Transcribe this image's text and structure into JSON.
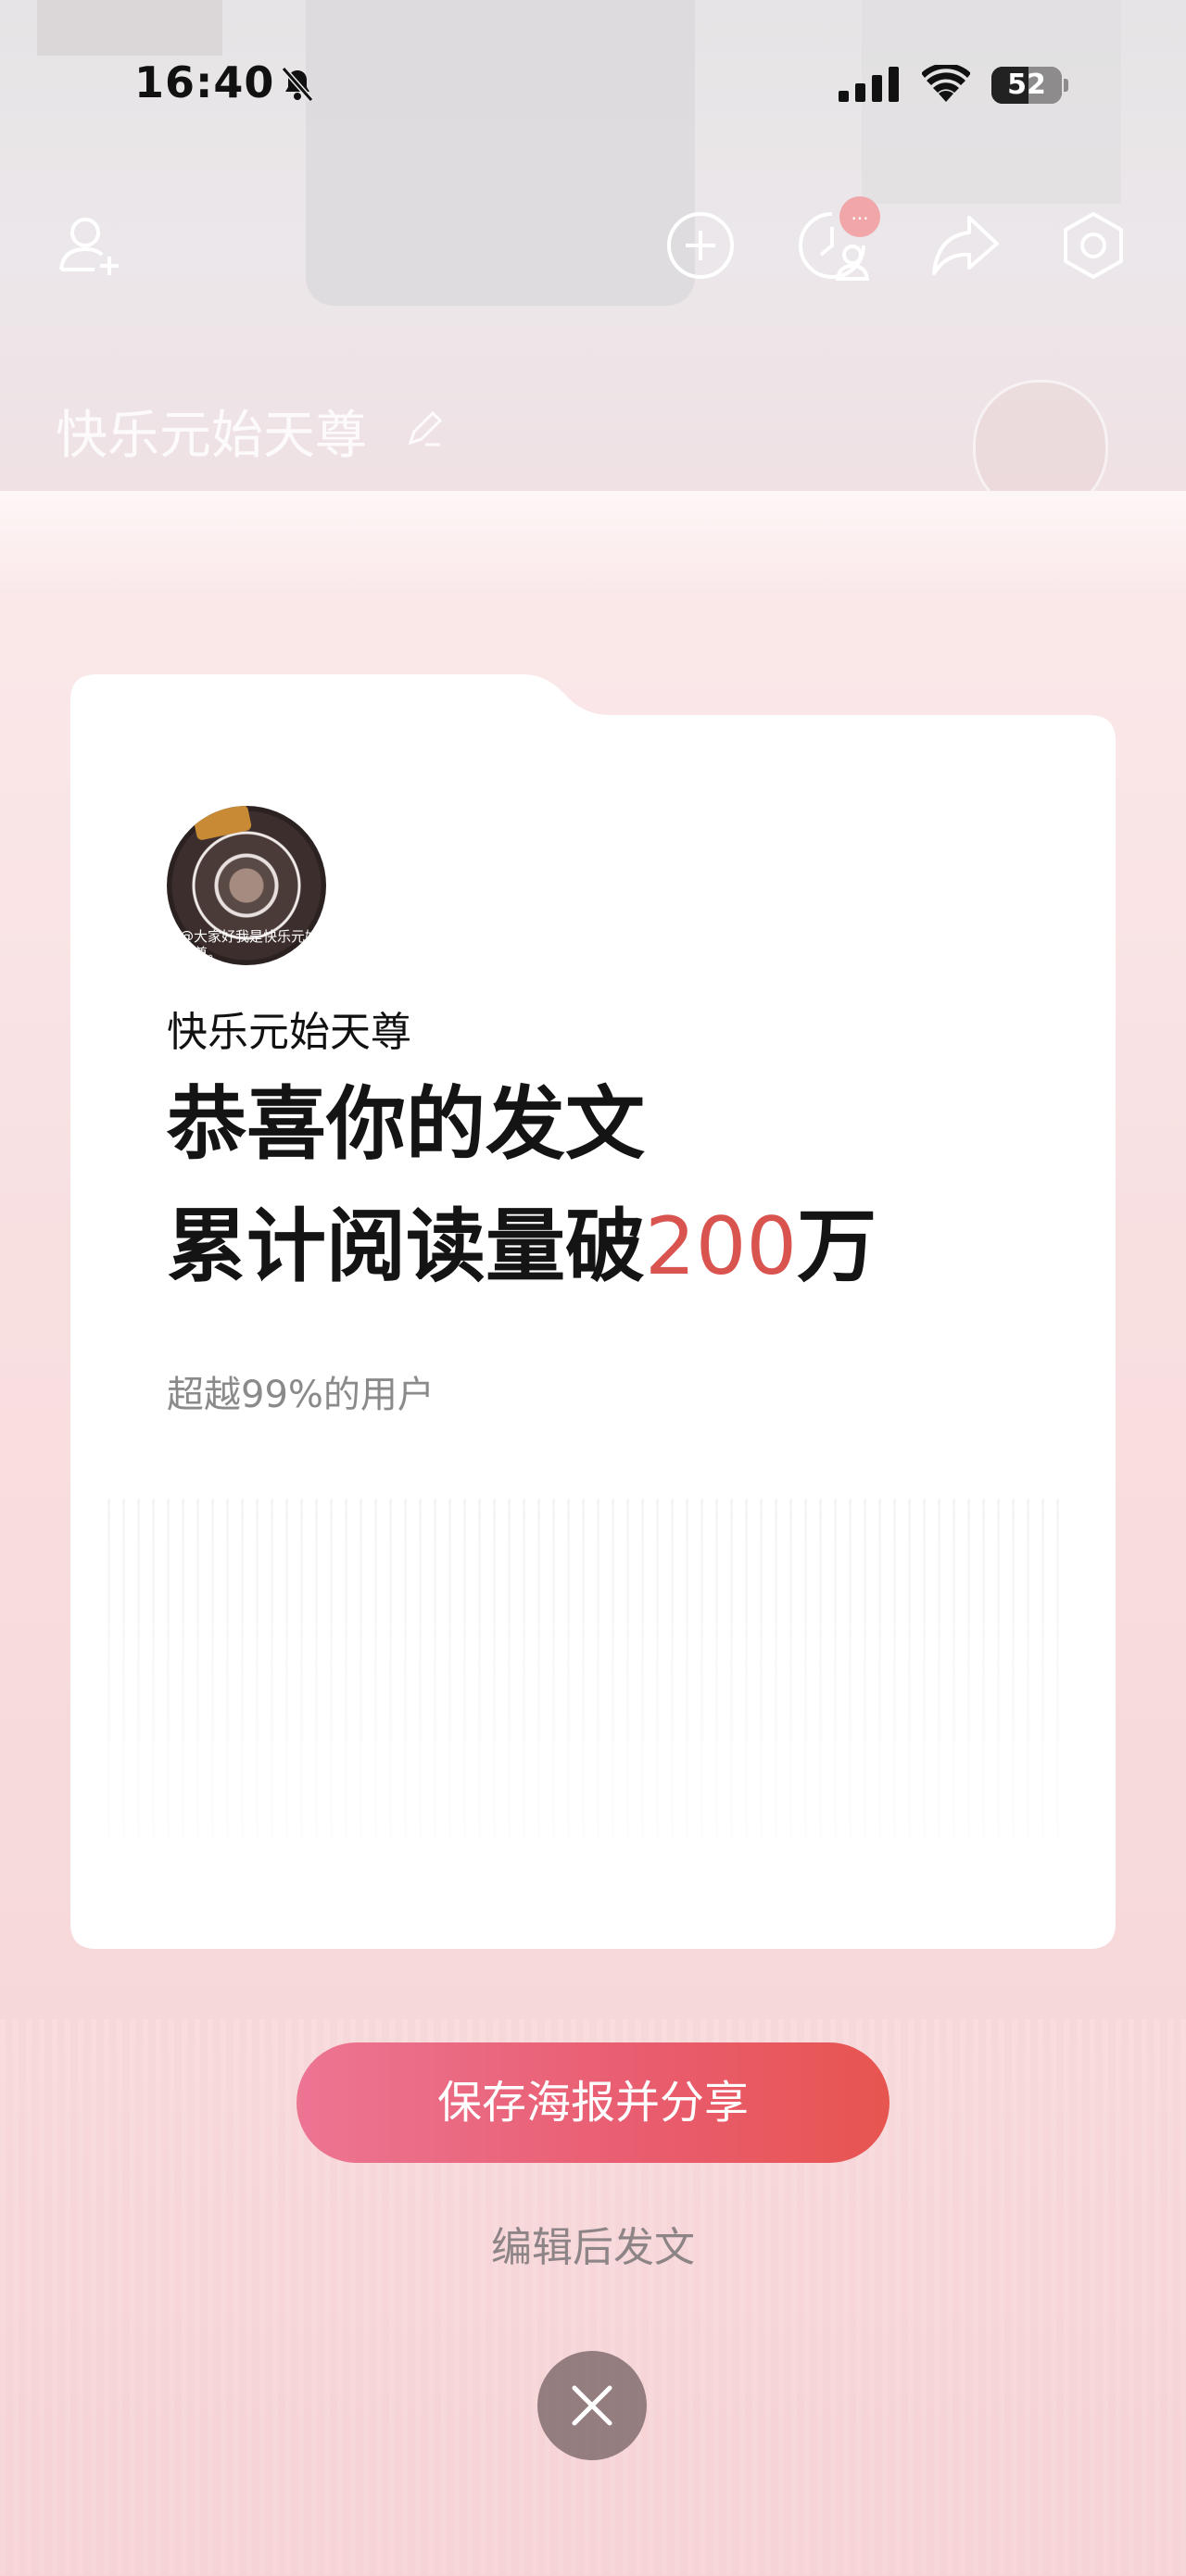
{
  "status_bar": {
    "time": "16:40",
    "battery": "52",
    "battery_percent": 52
  },
  "nav": {
    "icons": [
      "add-friend-icon",
      "add-circle-icon",
      "visitors-icon",
      "share-icon",
      "settings-icon"
    ],
    "badge_text": "..."
  },
  "profile": {
    "name": "快乐元始天尊"
  },
  "poster": {
    "username": "快乐元始天尊",
    "headline_line1": "恭喜你的发文",
    "headline_line2_prefix": "累计阅读量破",
    "headline_number": "200",
    "headline_suffix": "万",
    "subtitle": "超越99%的用户",
    "avatar_caption": "@大家好我是快乐元始天尊。"
  },
  "actions": {
    "share_label": "保存海报并分享",
    "edit_label": "编辑后发文"
  },
  "colors": {
    "accent": "#d9534f",
    "button_gradient_start": "#ec7593",
    "button_gradient_end": "#e75550",
    "background": "#f6d6d8"
  }
}
